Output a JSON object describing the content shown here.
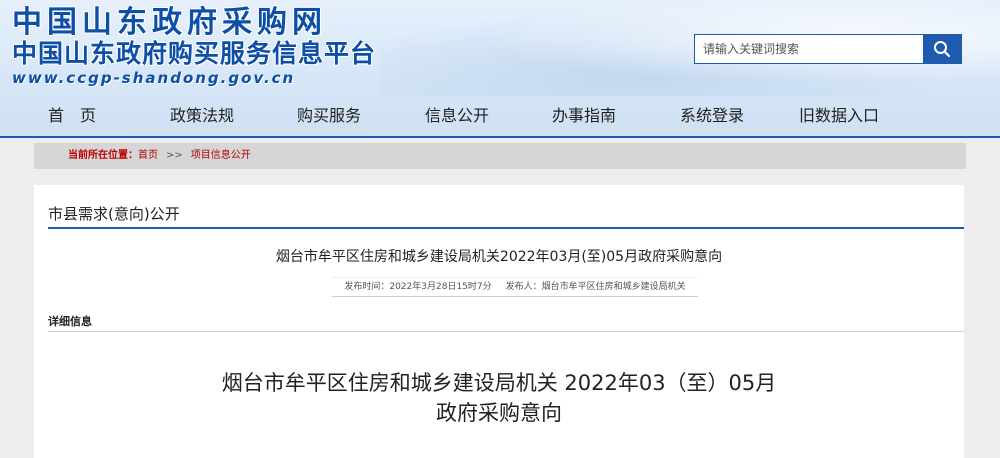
{
  "header": {
    "logo_line1": "中国山东政府采购网",
    "logo_line2": "中国山东政府购买服务信息平台",
    "logo_url": "www.ccgp-shandong.gov.cn",
    "search_placeholder": "请输入关键词搜索"
  },
  "nav": {
    "items": [
      {
        "label": "首　页"
      },
      {
        "label": "政策法规"
      },
      {
        "label": "购买服务"
      },
      {
        "label": "信息公开"
      },
      {
        "label": "办事指南"
      },
      {
        "label": "系统登录"
      },
      {
        "label": "旧数据入口"
      }
    ]
  },
  "breadcrumb": {
    "label": "当前所在位置：",
    "home": "首页",
    "separator": ">>",
    "current": "项目信息公开"
  },
  "section": {
    "title": "市县需求(意向)公开"
  },
  "notice": {
    "title": "烟台市牟平区住房和城乡建设局机关2022年03月(至)05月政府采购意向",
    "publish_time": "发布时间：2022年3月28日15时7分",
    "publisher": "发布人：烟台市牟平区住房和城乡建设局机关"
  },
  "detail": {
    "label": "详细信息",
    "doc_title_line1": "烟台市牟平区住房和城乡建设局机关 2022年03（至）05月",
    "doc_title_line2": "政府采购意向"
  },
  "colors": {
    "brand_blue": "#1e5bb0",
    "breadcrumb_red": "#b00000"
  },
  "icons": {
    "search": "search-icon"
  }
}
